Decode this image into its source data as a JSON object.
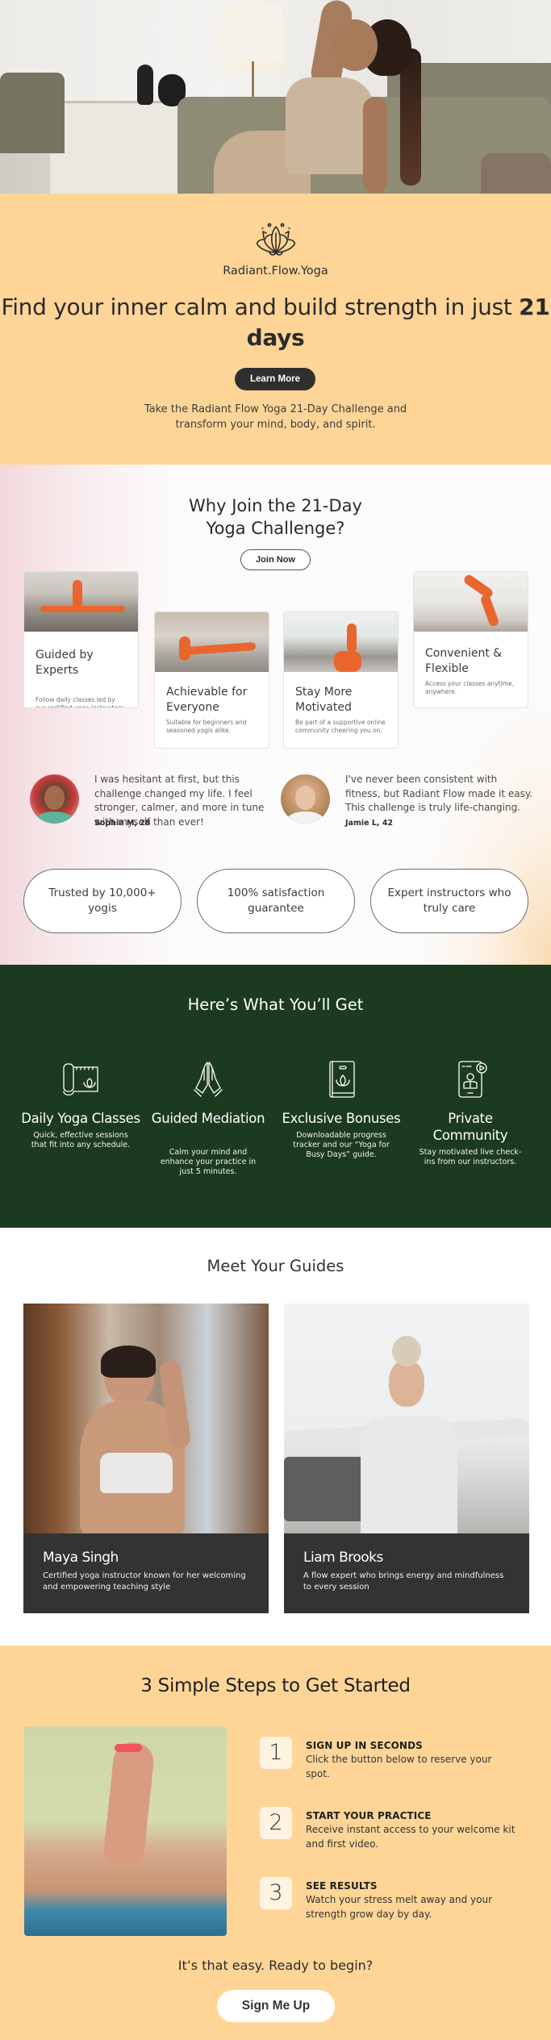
{
  "hero": {
    "image_alt": "Woman stretching in a yoga pose in a bright living room"
  },
  "intro": {
    "logo_icon": "lotus-icon",
    "brand": "Radiant.Flow.Yoga",
    "headline_part1": "Find your inner calm and build strength in just ",
    "headline_bold": "21 days",
    "cta_label": "Learn More",
    "subtext": "Take the Radiant Flow Yoga 21-Day Challenge and transform your mind, body, and spirit."
  },
  "why": {
    "title": "Why Join the 21-Day Yoga Challenge?",
    "cta_label": "Join Now",
    "cards": [
      {
        "title": "Guided by Experts",
        "text": "Follow daily classes led by our certified yoga instructors."
      },
      {
        "title": "Achievable for Everyone",
        "text": "Suitable for beginners and seasoned yogis alike."
      },
      {
        "title": "Stay More Motivated",
        "text": "Be part of a supportive online community cheering you on."
      },
      {
        "title": "Convenient & Flexible",
        "text": "Access your classes anytime, anywhere."
      }
    ],
    "testimonials": [
      {
        "quote": "I was hesitant at first, but this challenge changed my life. I feel stronger, calmer, and more in tune with myself than ever!",
        "author": "Sophia M, 28"
      },
      {
        "quote": "I've never been consistent with fitness, but Radiant Flow made it easy. This challenge is truly life-changing.",
        "author": "Jamie L, 42"
      }
    ],
    "trust_pills": [
      "Trusted by 10,000+ yogis",
      "100% satisfaction guarantee",
      "Expert instructors who truly care"
    ]
  },
  "features": {
    "title": "Here’s What You’ll Get",
    "items": [
      {
        "icon": "yoga-mat-icon",
        "title": "Daily Yoga Classes",
        "text": "Quick, effective sessions that fit into any schedule."
      },
      {
        "icon": "praying-hands-icon",
        "title": "Guided Mediation",
        "text": "Calm your mind and enhance your practice in just 5 minutes."
      },
      {
        "icon": "guide-book-icon",
        "title": "Exclusive Bonuses",
        "text": "Downloadable progress tracker and our “Yoga for Busy Days” guide."
      },
      {
        "icon": "phone-video-icon",
        "title": "Private Community",
        "text": "Stay motivated live check-ins from our instructors."
      }
    ]
  },
  "guides": {
    "title": "Meet Your Guides",
    "people": [
      {
        "name": "Maya Singh",
        "bio": "Certified yoga instructor known for her welcoming and empowering teaching style"
      },
      {
        "name": "Liam Brooks",
        "bio": "A flow expert who brings energy and mindfulness to every session"
      }
    ]
  },
  "steps": {
    "title": "3 Simple Steps to Get Started",
    "items": [
      {
        "num": "1",
        "title": "SIGN UP IN SECONDS",
        "text": "Click the button below to reserve your spot."
      },
      {
        "num": "2",
        "title": "START YOUR PRACTICE",
        "text": "Receive instant access to your welcome kit and first video."
      },
      {
        "num": "3",
        "title": "SEE RESULTS",
        "text": "Watch your stress melt away and your strength grow day by day."
      }
    ],
    "ready_text": "It’s that easy. Ready to begin?",
    "cta_label": "Sign Me Up"
  },
  "colors": {
    "peach": "#ffd597",
    "forest_green": "#1c3a1f",
    "dark": "#2f2f2f",
    "accent_orange": "#e8662e"
  }
}
